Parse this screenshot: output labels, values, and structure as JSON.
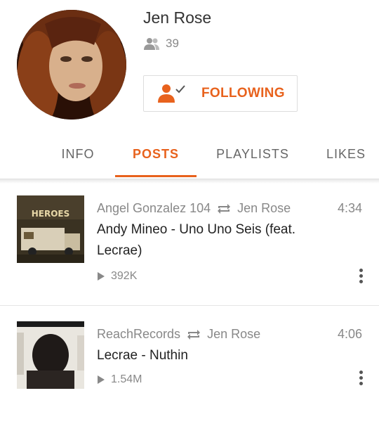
{
  "profile": {
    "name": "Jen Rose",
    "followers": "39",
    "follow_label": "FOLLOWING",
    "accent": "#e8621d"
  },
  "tabs": [
    {
      "label": "INFO",
      "active": false
    },
    {
      "label": "POSTS",
      "active": true
    },
    {
      "label": "PLAYLISTS",
      "active": false
    },
    {
      "label": "LIKES",
      "active": false
    }
  ],
  "posts": [
    {
      "uploader": "Angel Gonzalez 104",
      "reposter": "Jen Rose",
      "duration": "4:34",
      "title": "Andy Mineo - Uno Uno Seis (feat. Lecrae)",
      "plays": "392K",
      "thumb_text": "HEROES"
    },
    {
      "uploader": "ReachRecords",
      "reposter": "Jen Rose",
      "duration": "4:06",
      "title": "Lecrae - Nuthin",
      "plays": "1.54M"
    }
  ]
}
